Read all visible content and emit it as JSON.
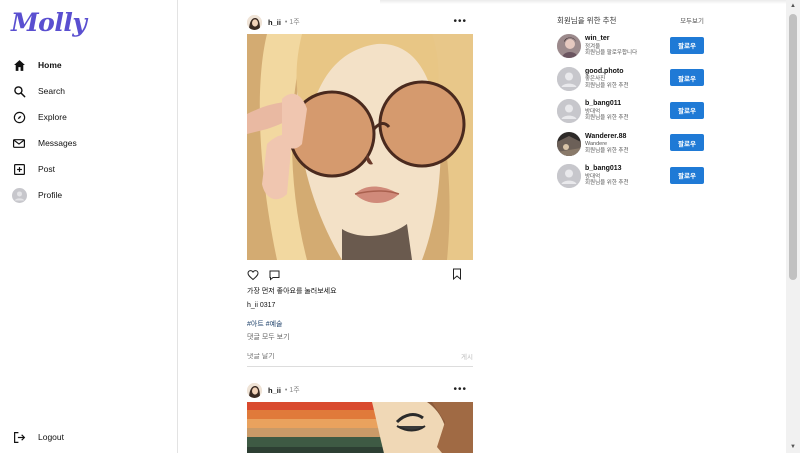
{
  "app": {
    "logo": "Molly"
  },
  "sidebar": {
    "items": [
      {
        "label": "Home",
        "icon": "home-icon"
      },
      {
        "label": "Search",
        "icon": "search-icon"
      },
      {
        "label": "Explore",
        "icon": "compass-icon"
      },
      {
        "label": "Messages",
        "icon": "mail-icon"
      },
      {
        "label": "Post",
        "icon": "plus-square-icon"
      },
      {
        "label": "Profile",
        "icon": "avatar-icon"
      }
    ],
    "logout": "Logout"
  },
  "feed": {
    "posts": [
      {
        "user": "h_ii",
        "time": "• 1주",
        "more": "•••",
        "likes": "가장 먼저 좋아요를 눌러보세요",
        "caption": "h_ii 0317",
        "tags": "#아트 #예술",
        "view_comments": "댓글 모두 보기",
        "comment_placeholder": "댓글 달기",
        "post_button": "게시"
      },
      {
        "user": "h_ii",
        "time": "• 1주",
        "more": "•••"
      }
    ]
  },
  "suggestions": {
    "title": "회원님을 위한 추천",
    "see_all": "모두보기",
    "follow_label": "팔로우",
    "items": [
      {
        "name": "win_ter",
        "sub": "정겨울",
        "reason": "회원님을 팔로우합니다"
      },
      {
        "name": "good.photo",
        "sub": "좋은사진",
        "reason": "회원님을 위한 추천"
      },
      {
        "name": "b_bang011",
        "sub": "방대억",
        "reason": "회원님을 위한 추천"
      },
      {
        "name": "Wanderer.88",
        "sub": "Wandere",
        "reason": "회원님을 위한 추천"
      },
      {
        "name": "b_bang013",
        "sub": "방대억",
        "reason": "회원님을 위한 추천"
      }
    ]
  },
  "colors": {
    "accent": "#1f7ad6",
    "logo": "#5a4fd0"
  }
}
